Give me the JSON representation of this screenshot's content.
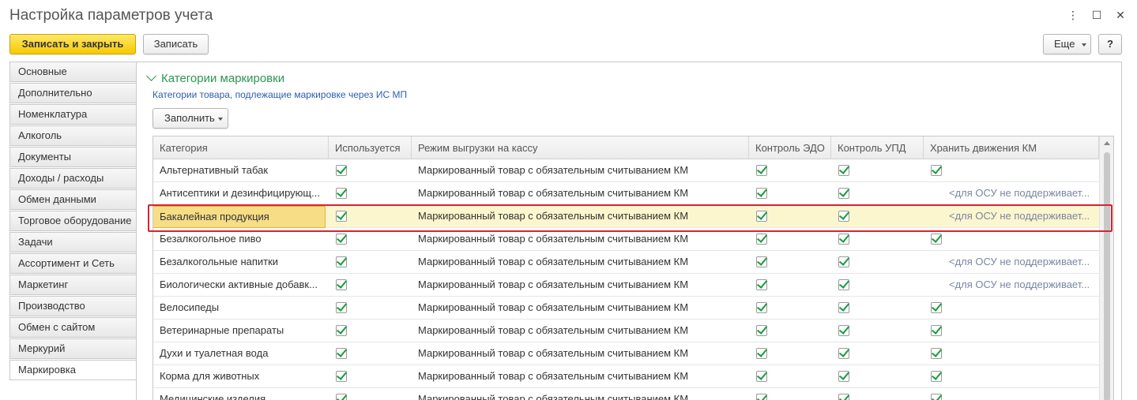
{
  "window": {
    "title": "Настройка параметров учета",
    "controls": {
      "more": "⋮",
      "maximize": "☐",
      "close": "✕"
    }
  },
  "toolbar": {
    "save_close_label": "Записать и закрыть",
    "save_label": "Записать",
    "more_label": "Еще",
    "help_label": "?"
  },
  "sidebar": {
    "items": [
      {
        "label": "Основные"
      },
      {
        "label": "Дополнительно"
      },
      {
        "label": "Номенклатура"
      },
      {
        "label": "Алкоголь"
      },
      {
        "label": "Документы"
      },
      {
        "label": "Доходы / расходы"
      },
      {
        "label": "Обмен данными"
      },
      {
        "label": "Торговое оборудование"
      },
      {
        "label": "Задачи"
      },
      {
        "label": "Ассортимент и Сеть"
      },
      {
        "label": "Маркетинг"
      },
      {
        "label": "Производство"
      },
      {
        "label": "Обмен с сайтом"
      },
      {
        "label": "Меркурий"
      },
      {
        "label": "Маркировка",
        "active": true
      }
    ]
  },
  "section": {
    "title": "Категории маркировки",
    "subtitle": "Категории товара, подлежащие маркировке через ИС МП",
    "fill_button": "Заполнить"
  },
  "table": {
    "columns": [
      {
        "label": "Категория"
      },
      {
        "label": "Используется"
      },
      {
        "label": "Режим выгрузки на кассу"
      },
      {
        "label": "Контроль ЭДО"
      },
      {
        "label": "Контроль УПД"
      },
      {
        "label": "Хранить движения КМ"
      }
    ],
    "rows": [
      {
        "category": "Альтернативный табак",
        "used": true,
        "mode": "Маркированный товар с обязательным считыванием КМ",
        "edo": true,
        "upd": true,
        "km": true,
        "km_note": ""
      },
      {
        "category": "Антисептики и дезинфицирующ...",
        "used": true,
        "mode": "Маркированный товар с обязательным считыванием КМ",
        "edo": true,
        "upd": true,
        "km": false,
        "km_note": "<для ОСУ не поддерживает..."
      },
      {
        "category": "Бакалейная продукция",
        "used": true,
        "mode": "Маркированный товар с обязательным считыванием КМ",
        "edo": true,
        "upd": true,
        "km": false,
        "km_note": "<для ОСУ не поддерживает...",
        "selected": true
      },
      {
        "category": "Безалкогольное пиво",
        "used": true,
        "mode": "Маркированный товар с обязательным считыванием КМ",
        "edo": true,
        "upd": true,
        "km": true,
        "km_note": ""
      },
      {
        "category": "Безалкогольные напитки",
        "used": true,
        "mode": "Маркированный товар с обязательным считыванием КМ",
        "edo": true,
        "upd": true,
        "km": false,
        "km_note": "<для ОСУ не поддерживает..."
      },
      {
        "category": "Биологически активные добавк...",
        "used": true,
        "mode": "Маркированный товар с обязательным считыванием КМ",
        "edo": true,
        "upd": true,
        "km": false,
        "km_note": "<для ОСУ не поддерживает..."
      },
      {
        "category": "Велосипеды",
        "used": true,
        "mode": "Маркированный товар с обязательным считыванием КМ",
        "edo": true,
        "upd": true,
        "km": true,
        "km_note": ""
      },
      {
        "category": "Ветеринарные препараты",
        "used": true,
        "mode": "Маркированный товар с обязательным считыванием КМ",
        "edo": true,
        "upd": true,
        "km": true,
        "km_note": ""
      },
      {
        "category": "Духи и туалетная вода",
        "used": true,
        "mode": "Маркированный товар с обязательным считыванием КМ",
        "edo": true,
        "upd": true,
        "km": true,
        "km_note": ""
      },
      {
        "category": "Корма для животных",
        "used": true,
        "mode": "Маркированный товар с обязательным считыванием КМ",
        "edo": true,
        "upd": true,
        "km": true,
        "km_note": ""
      },
      {
        "category": "Медицинские изделия",
        "used": true,
        "mode": "Маркированный товар с обязательным считыванием КМ",
        "edo": true,
        "upd": true,
        "km": true,
        "km_note": ""
      }
    ]
  },
  "colors": {
    "accent_green": "#2e9650",
    "link_blue": "#2c5eb0",
    "primary_button": "#f6c900",
    "selected_row": "#fcf6cf",
    "current_cell": "#f6dd86",
    "highlight_frame": "#d8232f"
  },
  "icons": {
    "section_toggle": "chevron-down-icon",
    "checkbox": "checkbox-checked-icon",
    "dropdown": "caret-down-icon"
  }
}
